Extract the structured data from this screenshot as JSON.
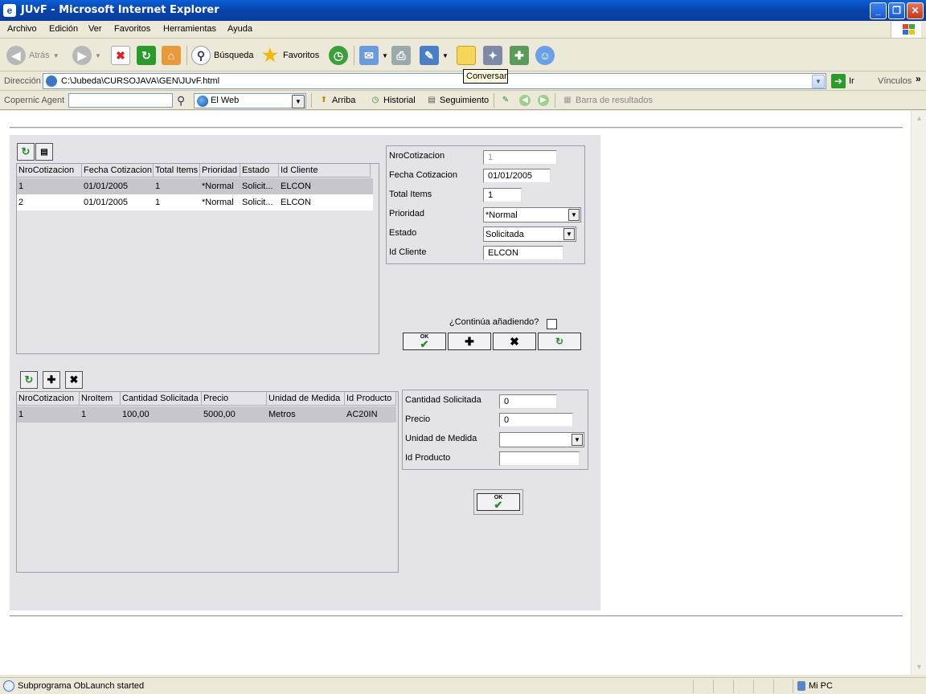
{
  "window": {
    "title": "JUvF - Microsoft Internet Explorer"
  },
  "menu": [
    "Archivo",
    "Edición",
    "Ver",
    "Favoritos",
    "Herramientas",
    "Ayuda"
  ],
  "toolbar": {
    "back": "Atrás",
    "search": "Búsqueda",
    "favorites": "Favoritos",
    "tooltip": "Conversar"
  },
  "address": {
    "label": "Dirección",
    "value": "C:\\Jubeda\\CURSOJAVA\\GEN\\JUvF.html",
    "go": "Ir",
    "links": "Vínculos"
  },
  "copernic": {
    "label": "Copernic Agent",
    "scope": "El Web",
    "up": "Arriba",
    "history": "Historial",
    "tracking": "Seguimiento",
    "results": "Barra de resultados"
  },
  "master_grid": {
    "columns": [
      "NroCotizacion",
      "Fecha Cotizacion",
      "Total Items",
      "Prioridad",
      "Estado",
      "Id Cliente"
    ],
    "rows": [
      [
        "1",
        "01/01/2005",
        "1",
        "*Normal",
        "Solicit...",
        "ELCON"
      ],
      [
        "2",
        "01/01/2005",
        "1",
        "*Normal",
        "Solicit...",
        "ELCON"
      ]
    ]
  },
  "master_form": {
    "nro_label": "NroCotizacion",
    "nro_value": "1",
    "fecha_label": "Fecha Cotizacion",
    "fecha_value": "01/01/2005",
    "total_label": "Total Items",
    "total_value": "1",
    "prioridad_label": "Prioridad",
    "prioridad_value": "*Normal",
    "estado_label": "Estado",
    "estado_value": "Solicitada",
    "cliente_label": "Id Cliente",
    "cliente_value": "ELCON"
  },
  "continue_label": "¿Continúa añadiendo?",
  "ok_text": "OK",
  "detail_grid": {
    "columns": [
      "NroCotizacion",
      "NroItem",
      "Cantidad Solicitada",
      "Precio",
      "Unidad de Medida",
      "Id Producto"
    ],
    "rows": [
      [
        "1",
        "1",
        "100,00",
        "5000,00",
        "Metros",
        "AC20IN"
      ]
    ]
  },
  "detail_form": {
    "cantidad_label": "Cantidad Solicitada",
    "cantidad_value": "0",
    "precio_label": "Precio",
    "precio_value": "0",
    "unidad_label": "Unidad de Medida",
    "unidad_value": "",
    "producto_label": "Id Producto",
    "producto_value": ""
  },
  "status": {
    "text": "Subprograma ObLaunch started",
    "zone": "Mi PC"
  }
}
